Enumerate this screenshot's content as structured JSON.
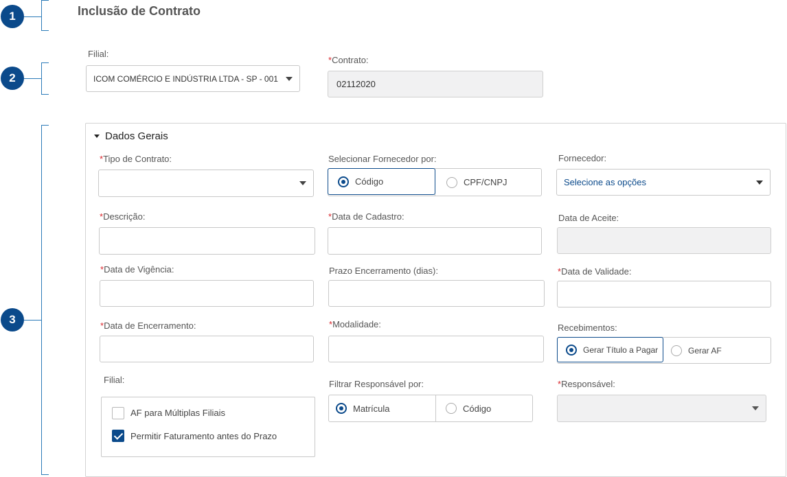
{
  "badges": [
    "1",
    "2",
    "3"
  ],
  "page_title": "Inclusão de Contrato",
  "filial": {
    "label": "Filial:",
    "value": "ICOM COMÉRCIO E INDÚSTRIA LTDA - SP - 001"
  },
  "contrato": {
    "required_mark": "*",
    "label": "Contrato:",
    "value": "02112020"
  },
  "section": {
    "title": "Dados Gerais"
  },
  "fields": {
    "tipo_contrato": {
      "required_mark": "*",
      "label": "Tipo de Contrato:",
      "value": ""
    },
    "selecionar_fornecedor": {
      "label": "Selecionar Fornecedor por:",
      "options": [
        "Código",
        "CPF/CNPJ"
      ],
      "selected": "Código"
    },
    "fornecedor": {
      "label": "Fornecedor:",
      "value": "Selecione as opções"
    },
    "descricao": {
      "required_mark": "*",
      "label": "Descrição:",
      "value": ""
    },
    "data_cadastro": {
      "required_mark": "*",
      "label": "Data de Cadastro:",
      "value": ""
    },
    "data_aceite": {
      "label": "Data de Aceite:",
      "value": ""
    },
    "data_vigencia": {
      "required_mark": "*",
      "label": "Data de Vigência:",
      "value": ""
    },
    "prazo_encerramento": {
      "label": "Prazo Encerramento (dias):",
      "value": ""
    },
    "data_validade": {
      "required_mark": "*",
      "label": "Data de Validade:",
      "value": ""
    },
    "data_encerramento": {
      "required_mark": "*",
      "label": "Data de Encerramento:",
      "value": ""
    },
    "modalidade": {
      "required_mark": "*",
      "label": "Modalidade:",
      "value": ""
    },
    "recebimentos": {
      "label": "Recebimentos:",
      "options": [
        "Gerar Título a Pagar",
        "Gerar AF"
      ],
      "selected": "Gerar Título a Pagar"
    },
    "filial_opcoes": {
      "label": "Filial:",
      "checkboxes": [
        {
          "label": "AF para Múltiplas Filiais",
          "checked": false
        },
        {
          "label": "Permitir Faturamento antes do Prazo",
          "checked": true
        }
      ]
    },
    "filtrar_responsavel": {
      "label": "Filtrar Responsável por:",
      "options": [
        "Matrícula",
        "Código"
      ],
      "selected": "Matrícula"
    },
    "responsavel": {
      "required_mark": "*",
      "label": "Responsável:",
      "value": ""
    }
  },
  "colors": {
    "primary": "#0b4a8b",
    "bracket": "#2a7ab8",
    "required": "#d9262c"
  }
}
